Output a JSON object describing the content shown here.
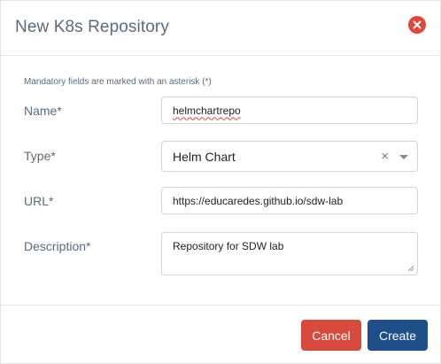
{
  "dialog": {
    "title": "New K8s Repository",
    "mandatory_note": "Mandatory fields are marked with an asterisk (*)"
  },
  "form": {
    "name": {
      "label": "Name*",
      "value": "helmchartrepo"
    },
    "type": {
      "label": "Type*",
      "value": "Helm Chart",
      "clear_symbol": "×"
    },
    "url": {
      "label": "URL*",
      "value": "https://educaredes.github.io/sdw-lab"
    },
    "description": {
      "label": "Description*",
      "value": "Repository for SDW lab"
    }
  },
  "footer": {
    "cancel_label": "Cancel",
    "create_label": "Create"
  },
  "colors": {
    "cancel": "#d84b3c",
    "create": "#1f4f8a",
    "close": "#e0483b"
  },
  "icons": {
    "close": "close-circle-icon",
    "clear": "clear-x-icon",
    "dropdown": "caret-down-icon",
    "resize": "resize-handle-icon"
  }
}
